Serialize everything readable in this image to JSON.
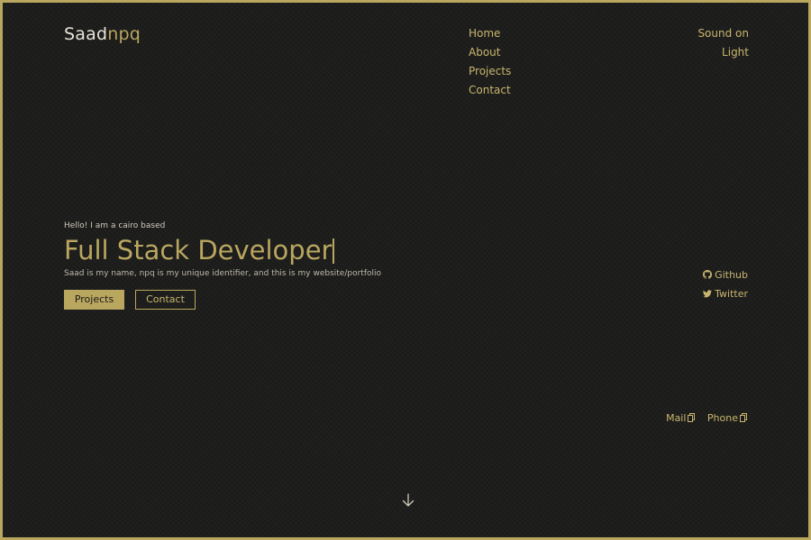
{
  "logo": {
    "part1": "Saad",
    "part2": "npq"
  },
  "nav": {
    "items": [
      "Home",
      "About",
      "Projects",
      "Contact"
    ]
  },
  "prefs": {
    "sound": "Sound on",
    "theme": "Light"
  },
  "hero": {
    "greeting": "Hello! I am a cairo based",
    "title": "Full Stack Developer",
    "tagline": "Saad is my name, npq is my unique identifier, and this is my website/portfolio"
  },
  "buttons": {
    "projects": "Projects",
    "contact": "Contact"
  },
  "social": {
    "github": {
      "label": "Github",
      "icon": "github-icon"
    },
    "twitter": {
      "label": "Twitter",
      "icon": "twitter-icon"
    }
  },
  "contacts": {
    "mail": {
      "label": "Mail",
      "icon": "copy-icon"
    },
    "phone": {
      "label": "Phone",
      "icon": "copy-icon"
    }
  },
  "scroll": {
    "icon": "arrow-down-icon"
  },
  "colors": {
    "accent": "#b9a65f",
    "background": "#1b1b1a",
    "text": "#e8e4d6"
  }
}
